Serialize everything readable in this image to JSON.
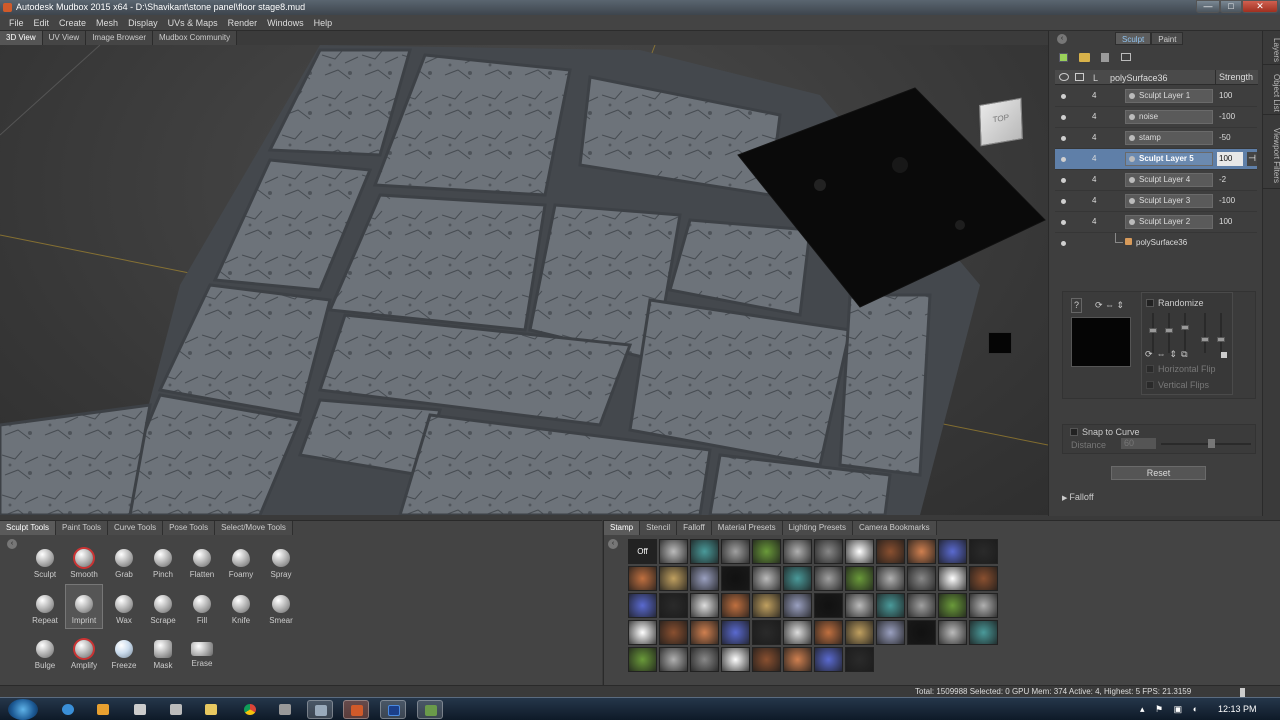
{
  "window": {
    "title": "Autodesk Mudbox 2015 x64 - D:\\Shavikant\\stone panel\\floor stage8.mud",
    "minimize": "—",
    "maximize": "□",
    "close": "✕"
  },
  "menu": [
    "File",
    "Edit",
    "Create",
    "Mesh",
    "Display",
    "UVs & Maps",
    "Render",
    "Windows",
    "Help"
  ],
  "view_tabs": [
    "3D View",
    "UV View",
    "Image Browser",
    "Mudbox Community"
  ],
  "viewcube": {
    "label": "TOP"
  },
  "mode_tabs": {
    "sculpt": "Sculpt",
    "paint": "Paint"
  },
  "layers": {
    "header": {
      "visibility": "",
      "lock": "",
      "level": "L",
      "name": "polySurface36",
      "strength": "Strength"
    },
    "rows": [
      {
        "level": "4",
        "name": "Sculpt Layer 1",
        "strength": "100"
      },
      {
        "level": "4",
        "name": "noise",
        "strength": "-100"
      },
      {
        "level": "4",
        "name": "stamp",
        "strength": "-50"
      },
      {
        "level": "4",
        "name": "Sculpt Layer 5",
        "strength": "100"
      },
      {
        "level": "4",
        "name": "Sculpt Layer 4",
        "strength": "-2"
      },
      {
        "level": "4",
        "name": "Sculpt Layer 3",
        "strength": "-100"
      },
      {
        "level": "4",
        "name": "Sculpt Layer 2",
        "strength": "100"
      }
    ],
    "selected_index": 3,
    "base_mesh": "polySurface36"
  },
  "stamp_props": {
    "randomize": "Randomize",
    "horizontal_flip": "Horizontal Flip",
    "vertical_flips": "Vertical Flips",
    "snap_to_curve": "Snap to Curve",
    "distance_label": "Distance",
    "distance_value": "60",
    "reset": "Reset",
    "falloff": "Falloff"
  },
  "side_tabs": [
    "Layers",
    "Object List",
    "Viewport Filters"
  ],
  "tool_tabs": [
    "Sculpt Tools",
    "Paint Tools",
    "Curve Tools",
    "Pose Tools",
    "Select/Move Tools"
  ],
  "tools": [
    [
      "Sculpt",
      "Smooth",
      "Grab",
      "Pinch",
      "Flatten",
      "Foamy",
      "Spray"
    ],
    [
      "Repeat",
      "Imprint",
      "Wax",
      "Scrape",
      "Fill",
      "Knife",
      "Smear"
    ],
    [
      "Bulge",
      "Amplify",
      "Freeze",
      "Mask",
      "Erase"
    ]
  ],
  "selected_tool": "Imprint",
  "stamp_tabs": [
    "Stamp",
    "Stencil",
    "Falloff",
    "Material Presets",
    "Lighting Presets",
    "Camera Bookmarks"
  ],
  "stamp_off": "Off",
  "status": "Total: 1509988  Selected: 0 GPU Mem: 374  Active: 4, Highest: 5  FPS: 21.3159",
  "taskbar": {
    "time": "12:13 PM"
  },
  "colors": {
    "selection_blue": "#5f7fa8",
    "panel": "#3e3e3e",
    "accent_tab": "#8fc2ee"
  }
}
